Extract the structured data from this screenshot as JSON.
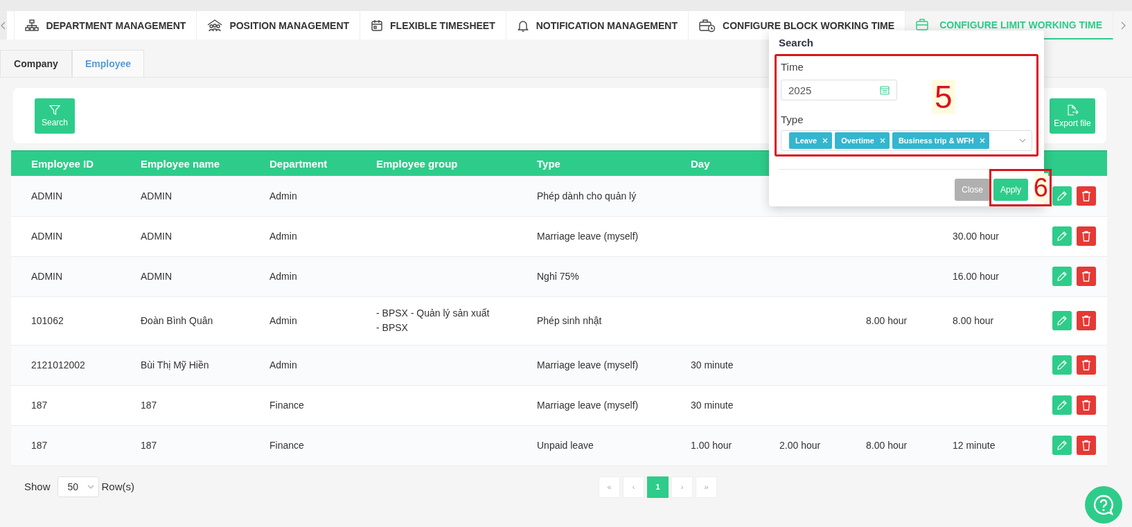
{
  "top_tabs": [
    {
      "label": "DEPARTMENT MANAGEMENT",
      "selected": false
    },
    {
      "label": "POSITION MANAGEMENT",
      "selected": false
    },
    {
      "label": "FLEXIBLE TIMESHEET",
      "selected": false
    },
    {
      "label": "NOTIFICATION MANAGEMENT",
      "selected": false
    },
    {
      "label": "CONFIGURE BLOCK WORKING TIME",
      "selected": false
    },
    {
      "label": "CONFIGURE LIMIT WORKING TIME",
      "selected": true
    }
  ],
  "sub_tabs": [
    {
      "label": "Company",
      "selected": false
    },
    {
      "label": "Employee",
      "selected": true
    }
  ],
  "toolbar": {
    "search_button": "Search",
    "export_button": "Export file"
  },
  "table": {
    "columns": [
      "Employee ID",
      "Employee name",
      "Department",
      "Employee group",
      "Type",
      "Day"
    ],
    "rows": [
      {
        "employee_id": "ADMIN",
        "employee_name": "ADMIN",
        "department": "Admin",
        "type": "Phép dành cho quản lý"
      },
      {
        "employee_id": "ADMIN",
        "employee_name": "ADMIN",
        "department": "Admin",
        "type": "Marriage leave (myself)",
        "column_9": "30.00 hour"
      },
      {
        "employee_id": "ADMIN",
        "employee_name": "ADMIN",
        "department": "Admin",
        "type": "Nghỉ 75%",
        "column_9": "16.00 hour"
      },
      {
        "employee_id": "101062",
        "employee_name": "Đoàn Bình Quân",
        "department": "Admin",
        "employee_group": [
          "- BPSX - Quản lý sản xuất",
          "- BPSX"
        ],
        "type": "Phép sinh nhật",
        "column_8": "8.00 hour",
        "column_9": "8.00 hour"
      },
      {
        "employee_id": "2121012002",
        "employee_name": "Bùi Thị Mỹ Hiền",
        "department": "Admin",
        "type": "Marriage leave (myself)",
        "day": "30 minute"
      },
      {
        "employee_id": "187",
        "employee_name": "187",
        "department": "Finance",
        "type": "Marriage leave (myself)",
        "day": "30 minute"
      },
      {
        "employee_id": "187",
        "employee_name": "187",
        "department": "Finance",
        "type": "Unpaid leave",
        "day": "1.00 hour",
        "column_7": "2.00 hour",
        "column_8": "8.00 hour",
        "column_9": "12 minute"
      }
    ]
  },
  "footer": {
    "show_label": "Show",
    "page_size": "50",
    "rows_label": "Row(s)"
  },
  "pagination": {
    "first": "«",
    "previous": "‹",
    "pages": [
      {
        "label": "1",
        "selected": true
      }
    ],
    "next": "›",
    "last": "»"
  },
  "search_popup": {
    "title": "Search",
    "time_label": "Time",
    "time_value": "2025",
    "type_label": "Type",
    "type_tags": [
      "Leave",
      "Overtime",
      "Business trip & WFH"
    ],
    "close_button": "Close",
    "apply_button": "Apply"
  },
  "annotations": [
    {
      "label": "5"
    },
    {
      "label": "6"
    }
  ]
}
